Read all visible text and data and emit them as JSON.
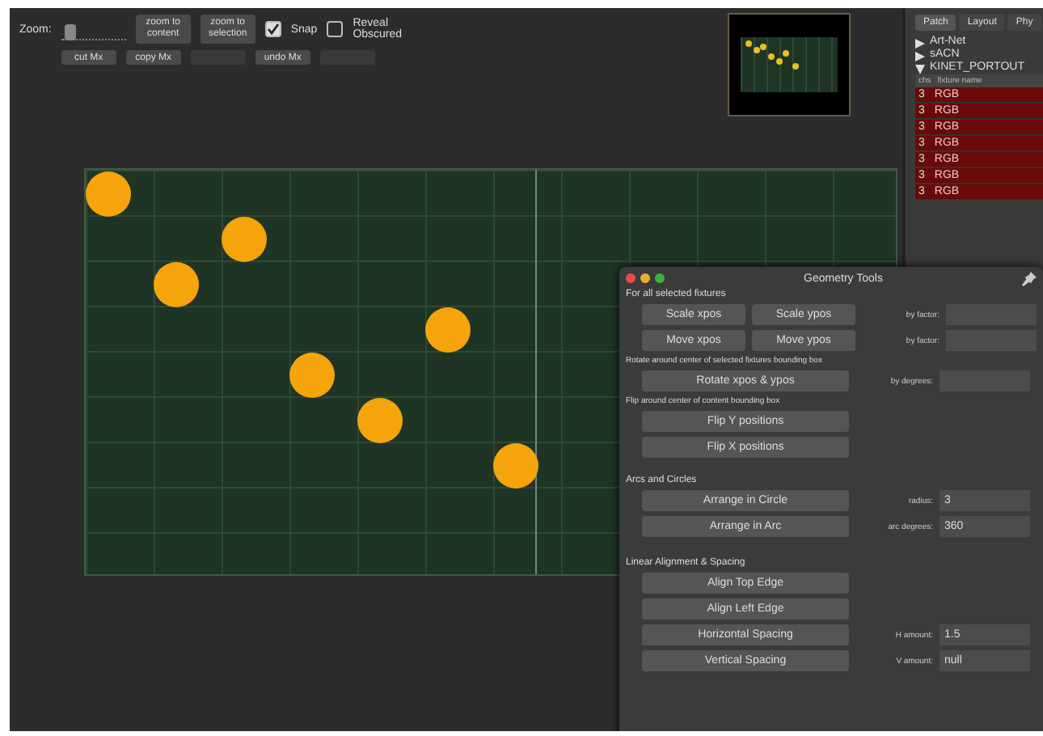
{
  "toolbar": {
    "zoom": {
      "label": "Zoom:",
      "level": 0.05
    },
    "top_buttons": [
      {
        "label": "zoom to\ncontent",
        "disabled": false
      },
      {
        "label": "zoom to\nselection",
        "disabled": false
      }
    ],
    "checkboxes": [
      {
        "label": "Snap",
        "checked": true
      },
      {
        "label": "Reveal\nObscured",
        "checked": false
      }
    ],
    "bottom_buttons": [
      {
        "label": "cut Mx",
        "disabled": false
      },
      {
        "label": "copy Mx",
        "disabled": false
      },
      {
        "disabled": true
      },
      {
        "label": "undo Mx",
        "disabled": false
      },
      {
        "disabled": true
      }
    ]
  },
  "canvas": {
    "fixtures": [
      {
        "selected": true
      },
      {
        "selected": true
      },
      {
        "selected": true
      },
      {
        "selected": true
      },
      {
        "selected": true
      },
      {
        "selected": true
      },
      {
        "selected": true
      }
    ]
  },
  "sidebar": {
    "tabs": [
      {
        "label": "Patch",
        "selected": true
      },
      {
        "label": "Layout",
        "selected": false
      },
      {
        "label": "Phy",
        "selected": false
      }
    ],
    "tree": [
      {
        "label": "Art-Net",
        "expanded": false
      },
      {
        "label": "sACN",
        "expanded": false
      },
      {
        "label": "KINET_PORTOUT",
        "expanded": true
      }
    ],
    "columns": [
      "chs",
      "fixture name"
    ],
    "rows": [
      {
        "chs": "3",
        "name": "RGB",
        "selected": true
      },
      {
        "chs": "3",
        "name": "RGB",
        "selected": true
      },
      {
        "chs": "3",
        "name": "RGB",
        "selected": true
      },
      {
        "chs": "3",
        "name": "RGB",
        "selected": true
      },
      {
        "chs": "3",
        "name": "RGB",
        "selected": true
      },
      {
        "chs": "3",
        "name": "RGB",
        "selected": true
      },
      {
        "chs": "3",
        "name": "RGB",
        "selected": true
      }
    ]
  },
  "geometry_window": {
    "title": "Geometry Tools",
    "sections": [
      {
        "heading": "For all selected fixtures",
        "rows": [
          {
            "buttons": [
              "Scale xpos",
              "Scale ypos"
            ],
            "field_label": "by factor:"
          },
          {
            "buttons": [
              "Move xpos",
              "Move ypos"
            ],
            "field_label": "by factor:"
          }
        ]
      },
      {
        "heading": "Rotate around center of selected fixtures bounding box",
        "rows": [
          {
            "buttons": [
              "Rotate xpos & ypos"
            ],
            "field_label": "by degrees:"
          }
        ]
      },
      {
        "heading": "Flip around center of content bounding box",
        "rows": [
          {
            "buttons": [
              "Flip Y positions"
            ]
          },
          {
            "buttons": [
              "Flip X positions"
            ]
          }
        ]
      },
      {
        "heading": "Arcs and Circles",
        "rows": [
          {
            "buttons": [
              "Arrange in Circle"
            ],
            "field_label": "radius:",
            "value": "3"
          },
          {
            "buttons": [
              "Arrange in Arc"
            ],
            "field_label": "arc degrees:",
            "value": "360"
          }
        ]
      },
      {
        "heading": "Linear Alignment & Spacing",
        "rows": [
          {
            "buttons": [
              "Align Top Edge"
            ]
          },
          {
            "buttons": [
              "Align Left Edge"
            ]
          },
          {
            "buttons": [
              "Horizontal Spacing"
            ],
            "field_label": "H amount:",
            "value": "1.5"
          },
          {
            "buttons": [
              "Vertical Spacing"
            ],
            "field_label": "V amount:",
            "value": "null"
          }
        ]
      }
    ]
  }
}
